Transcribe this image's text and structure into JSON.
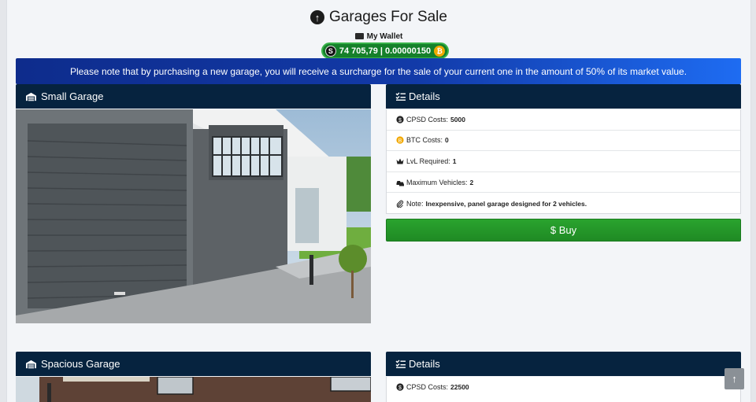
{
  "header": {
    "title": "Garages For Sale",
    "title_icon": "arrow-circle-up-icon",
    "wallet_label": "My Wallet",
    "balance": "74 705,79 | 0.00000150"
  },
  "notice": "Please note that by purchasing a new garage, you will receive a surcharge for the sale of your current one in the amount of 50% of its market value.",
  "garages": [
    {
      "name": "Small Garage",
      "details_title": "Details",
      "rows": [
        {
          "icon": "dollar-circle-icon",
          "label": "CPSD Costs:",
          "value": "5000"
        },
        {
          "icon": "bitcoin-icon",
          "label": "BTC Costs:",
          "value": "0"
        },
        {
          "icon": "crown-icon",
          "label": "LvL Required:",
          "value": "1"
        },
        {
          "icon": "cars-icon",
          "label": "Maximum Vehicles:",
          "value": "2"
        },
        {
          "icon": "paperclip-icon",
          "label": "Note:",
          "value": "Inexpensive, panel garage designed for 2 vehicles."
        }
      ],
      "buy_label": "$ Buy"
    },
    {
      "name": "Spacious Garage",
      "details_title": "Details",
      "rows": [
        {
          "icon": "dollar-circle-icon",
          "label": "CPSD Costs:",
          "value": "22500"
        }
      ]
    }
  ],
  "colors": {
    "header_dark": "#06233f",
    "notice_blue": "#123aa8",
    "buy_green": "#1f8a24",
    "wallet_green": "#15802a"
  }
}
